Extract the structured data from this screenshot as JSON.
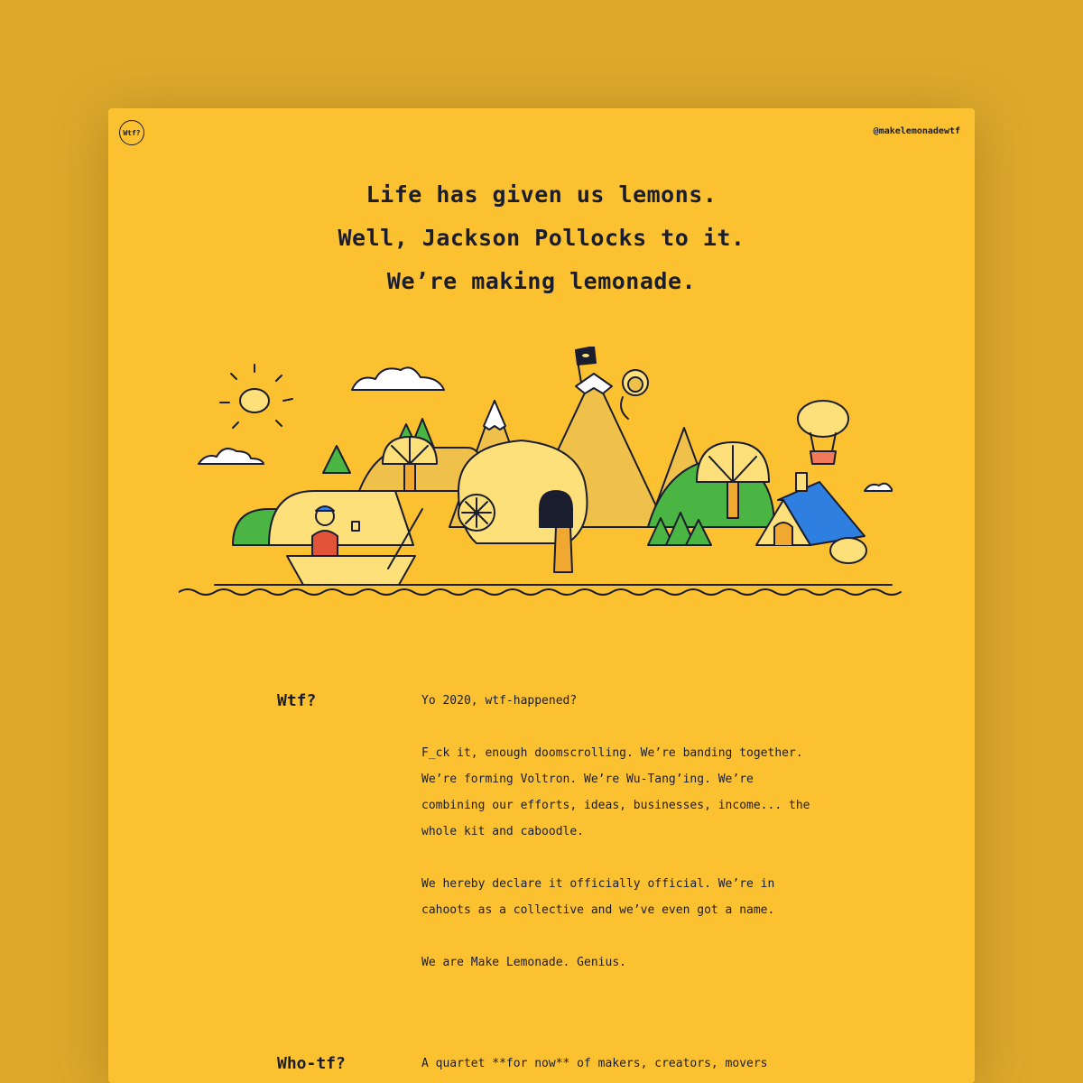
{
  "header": {
    "logo_text": "Wtf?",
    "handle": "@makelemonadewtf"
  },
  "hero": {
    "lines": [
      "Life has given us lemons.",
      "Well, Jackson Pollocks to it.",
      "We’re making lemonade."
    ]
  },
  "colors": {
    "page_bg": "#dca92c",
    "card_bg": "#fcc131",
    "ink": "#1a1d2e",
    "lemon": "#fde07a",
    "hill": "#f0c14a",
    "green": "#4bb543",
    "blue": "#2e7fe0"
  },
  "illustration": {
    "icons": [
      "sun-icon",
      "cloud-icon",
      "flag-icon",
      "monkey-icon",
      "hot-air-balloon-icon",
      "lemon-icon",
      "boat-icon",
      "house-icon",
      "waterfall-icon",
      "tree-icon",
      "wave-icon"
    ]
  },
  "sections": [
    {
      "title": "Wtf?",
      "paragraphs": [
        "Yo 2020, wtf-happened?",
        "F_ck it, enough doomscrolling. We’re banding together. We’re forming Voltron. We’re Wu-Tang’ing. We’re combining our efforts, ideas, businesses, income... the whole kit and caboodle.",
        "We hereby declare it officially official. We’re in cahoots as a collective and we’ve even got a name.",
        "We are Make Lemonade. Genius."
      ]
    },
    {
      "title": "Who-tf?",
      "paragraphs": [
        "A quartet **for now** of makers, creators, movers"
      ]
    }
  ]
}
